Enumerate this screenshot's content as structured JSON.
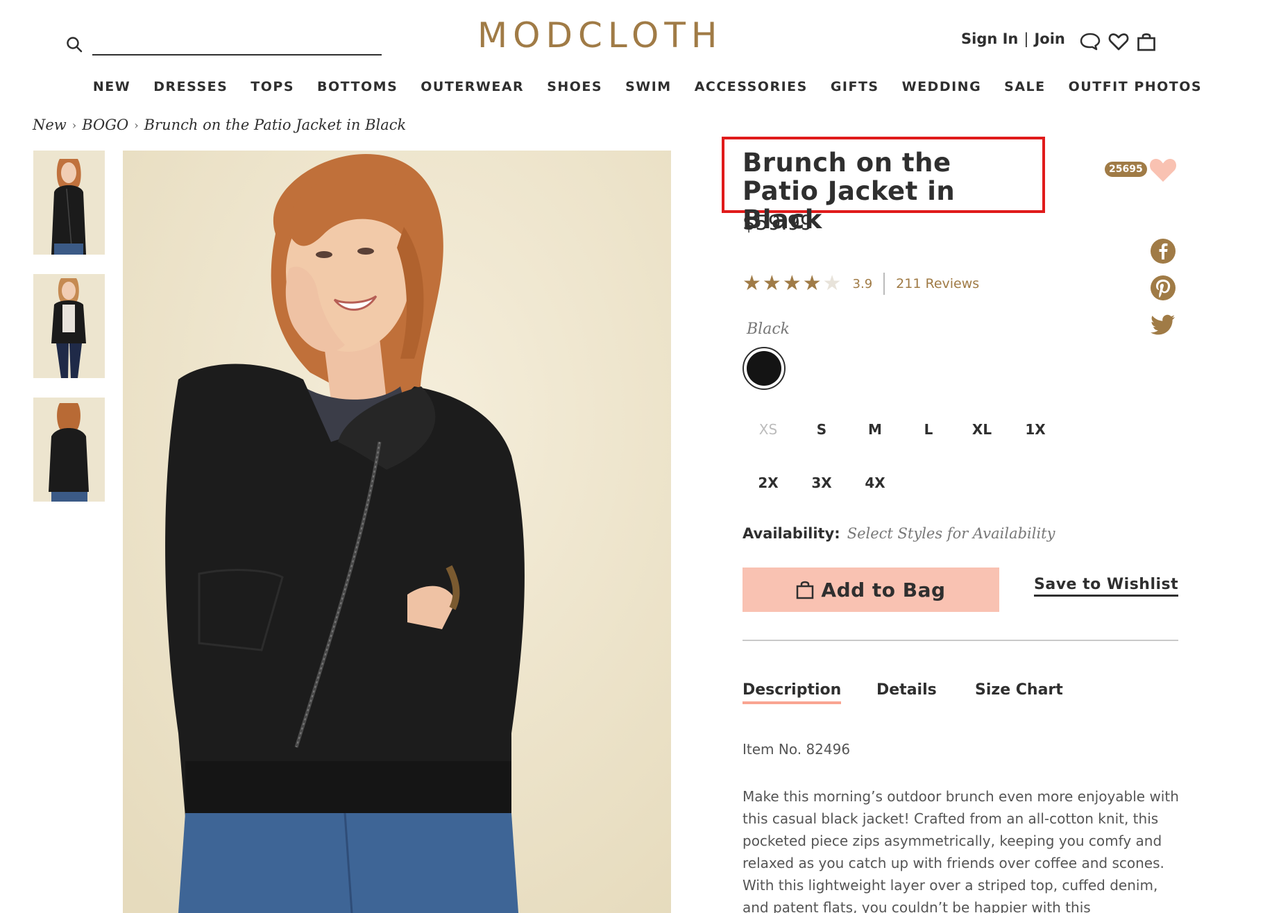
{
  "header": {
    "logo": "MODCLOTH",
    "search": {
      "placeholder": "",
      "value": ""
    },
    "account": {
      "sign_in": "Sign In",
      "separator": "|",
      "join": "Join"
    }
  },
  "nav": {
    "items": [
      "NEW",
      "DRESSES",
      "TOPS",
      "BOTTOMS",
      "OUTERWEAR",
      "SHOES",
      "SWIM",
      "ACCESSORIES",
      "GIFTS",
      "WEDDING",
      "SALE",
      "OUTFIT PHOTOS"
    ]
  },
  "breadcrumb": [
    "New",
    "BOGO",
    "Brunch on the Patio Jacket in Black"
  ],
  "product": {
    "title": "Brunch on the Patio Jacket in Black",
    "price": "$59.99",
    "heart_count": "25695",
    "rating": {
      "value": "3.9",
      "stars_filled": 4,
      "stars_total": 5,
      "reviews": "211 Reviews"
    },
    "color": {
      "selected_name": "Black",
      "swatch_hex": "#141414"
    },
    "sizes": [
      {
        "label": "XS",
        "available": false
      },
      {
        "label": "S",
        "available": true
      },
      {
        "label": "M",
        "available": true
      },
      {
        "label": "L",
        "available": true
      },
      {
        "label": "XL",
        "available": true
      },
      {
        "label": "1X",
        "available": true
      },
      {
        "label": "2X",
        "available": true
      },
      {
        "label": "3X",
        "available": true
      },
      {
        "label": "4X",
        "available": true
      }
    ],
    "availability": {
      "label": "Availability:",
      "value": "Select Styles for Availability"
    },
    "add_to_bag": "Add to Bag",
    "save_to_wishlist": "Save to Wishlist",
    "tabs": [
      {
        "label": "Description",
        "active": true
      },
      {
        "label": "Details",
        "active": false
      },
      {
        "label": "Size Chart",
        "active": false
      }
    ],
    "item_no": "Item No. 82496",
    "description": "Make this morning’s outdoor brunch even more enjoyable with this casual black jacket! Crafted from an all-cotton knit, this pocketed piece zips asymmetrically, keeping you comfy and relaxed as you catch up with friends over coffee and scones. With this lightweight layer over a striped top, cuffed denim, and patent flats, you couldn’t be happier with this"
  },
  "icons": {
    "search": "search-icon",
    "chat": "chat-icon",
    "wishlist": "heart-icon",
    "bag": "shopping-bag-icon",
    "facebook": "facebook-icon",
    "pinterest": "pinterest-icon",
    "twitter": "twitter-icon"
  },
  "colors": {
    "brand_gold": "#a07b46",
    "accent_pink": "#f9c2b2",
    "heart_pink": "#f9c2b2",
    "highlight_red": "#e01b1b",
    "text_dark": "#2f2f2f"
  }
}
